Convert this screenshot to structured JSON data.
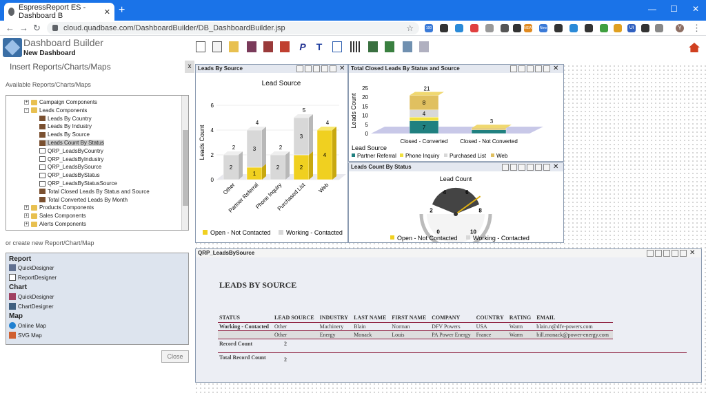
{
  "browser": {
    "tab_title": "EspressReport ES - Dashboard B",
    "url": "cloud.quadbase.com/DashboardBuilder/DB_DashboardBuilder.jsp",
    "badge_100": "100",
    "badge_new": "NEW",
    "badge_new2": "New",
    "profile": "Y",
    "ext_ui": "Ui"
  },
  "app": {
    "title": "Dashboard Builder",
    "subtitle": "New Dashboard",
    "insert_header": "Insert Reports/Charts/Maps",
    "close_x": "x",
    "available_label": "Available Reports/Charts/Maps",
    "create_label": "or create new Report/Chart/Map",
    "close_button": "Close"
  },
  "tree": {
    "items": [
      {
        "label": "Campaign Components",
        "type": "folder",
        "level": 0,
        "exp": "+"
      },
      {
        "label": "Leads Components",
        "type": "folder",
        "level": 0,
        "exp": "-"
      },
      {
        "label": "Leads By Country",
        "type": "rep",
        "level": 1
      },
      {
        "label": "Leads By Industry",
        "type": "rep",
        "level": 1
      },
      {
        "label": "Leads By Source",
        "type": "rep",
        "level": 1
      },
      {
        "label": "Leads Count By Status",
        "type": "rep",
        "level": 1,
        "selected": true
      },
      {
        "label": "QRP_LeadsByCountry",
        "type": "qrp",
        "level": 1
      },
      {
        "label": "QRP_LeadsByIndustry",
        "type": "qrp",
        "level": 1
      },
      {
        "label": "QRP_LeadsBySource",
        "type": "qrp",
        "level": 1
      },
      {
        "label": "QRP_LeadsByStatus",
        "type": "qrp",
        "level": 1
      },
      {
        "label": "QRP_LeadsByStatusSource",
        "type": "qrp",
        "level": 1
      },
      {
        "label": "Total Closed Leads By Status and Source",
        "type": "rep",
        "level": 1
      },
      {
        "label": "Total Converted Leads By Month",
        "type": "rep",
        "level": 1
      },
      {
        "label": "Products Components",
        "type": "folder",
        "level": 0,
        "exp": "+"
      },
      {
        "label": "Sales Components",
        "type": "folder",
        "level": 0,
        "exp": "+"
      },
      {
        "label": "Alerts Components",
        "type": "folder",
        "level": 0,
        "exp": "+"
      }
    ]
  },
  "creator": {
    "report_header": "Report",
    "chart_header": "Chart",
    "map_header": "Map",
    "quick1": "QuickDesigner",
    "report_designer": "ReportDesigner",
    "quick2": "QuickDesigner",
    "chart_designer": "ChartDesigner",
    "online_map": "Online Map",
    "svg_map": "SVG Map"
  },
  "toolbar": {
    "p_label": "P",
    "t_label": "T"
  },
  "panels": {
    "leads_by_source": "Leads By Source",
    "total_closed": "Total Closed Leads By Status and Source",
    "leads_count_status": "Leads Count By Status",
    "qrp": "QRP_LeadsBySource"
  },
  "chart_data": [
    {
      "type": "bar",
      "title": "Lead Source",
      "ylabel": "Leads Count",
      "xlabel": "",
      "categories": [
        "Other",
        "Partner Referral",
        "Phone Inquiry",
        "Purchased List",
        "Web"
      ],
      "series": [
        {
          "name": "Open - Not Contacted",
          "values": [
            0,
            1,
            0,
            2,
            4
          ]
        },
        {
          "name": "Working - Contacted",
          "values": [
            2,
            3,
            2,
            3,
            0
          ]
        }
      ],
      "totals": [
        2,
        4,
        2,
        5,
        4
      ],
      "ylim": [
        0,
        6
      ],
      "yticks": [
        0,
        2,
        4,
        6
      ],
      "legend": "bottom",
      "stacked": true,
      "colors": [
        "#f0d020",
        "#d8d8d8"
      ]
    },
    {
      "type": "bar",
      "title": "",
      "ylabel": "Leads Count",
      "legend_title": "Lead Source",
      "categories": [
        "Closed - Converted",
        "Closed - Not Converted"
      ],
      "series": [
        {
          "name": "Partner Referral",
          "values": [
            7,
            2
          ]
        },
        {
          "name": "Phone Inquiry",
          "values": [
            2,
            0
          ]
        },
        {
          "name": "Purchased List",
          "values": [
            4,
            0
          ]
        },
        {
          "name": "Web",
          "values": [
            8,
            1
          ]
        }
      ],
      "totals": [
        21,
        3
      ],
      "ylim": [
        0,
        25
      ],
      "yticks": [
        0,
        5,
        10,
        15,
        20,
        25
      ],
      "legend": "bottom",
      "stacked": true,
      "colors": [
        "#208080",
        "#f0e040",
        "#d8d8d8",
        "#e0c060"
      ]
    },
    {
      "type": "gauge",
      "title": "Lead Count",
      "ticks": [
        0,
        2,
        4,
        6,
        8,
        10
      ],
      "value": 7,
      "legend": "bottom",
      "series": [
        {
          "name": "Open - Not Contacted"
        },
        {
          "name": "Working - Contacted"
        }
      ],
      "colors": [
        "#f0d020",
        "#d8d8d8"
      ]
    }
  ],
  "qrp": {
    "title": "LEADS BY SOURCE",
    "columns": [
      "STATUS",
      "LEAD SOURCE",
      "INDUSTRY",
      "LAST NAME",
      "FIRST NAME",
      "COMPANY",
      "COUNTRY",
      "RATING",
      "EMAIL"
    ],
    "rows": [
      [
        "Working - Contacted",
        "Other",
        "Machinery",
        "Blain",
        "Norman",
        "DFV Powers",
        "USA",
        "Warm",
        "blain.n@dfv-powers.com"
      ],
      [
        "",
        "Other",
        "Energy",
        "Monack",
        "Louis",
        "PA Power Energy",
        "France",
        "Warm",
        "bill.monack@power-energy.com"
      ]
    ],
    "record_count_label": "Record Count",
    "record_count": "2",
    "total_label": "Total Record Count",
    "total_count": "2"
  }
}
